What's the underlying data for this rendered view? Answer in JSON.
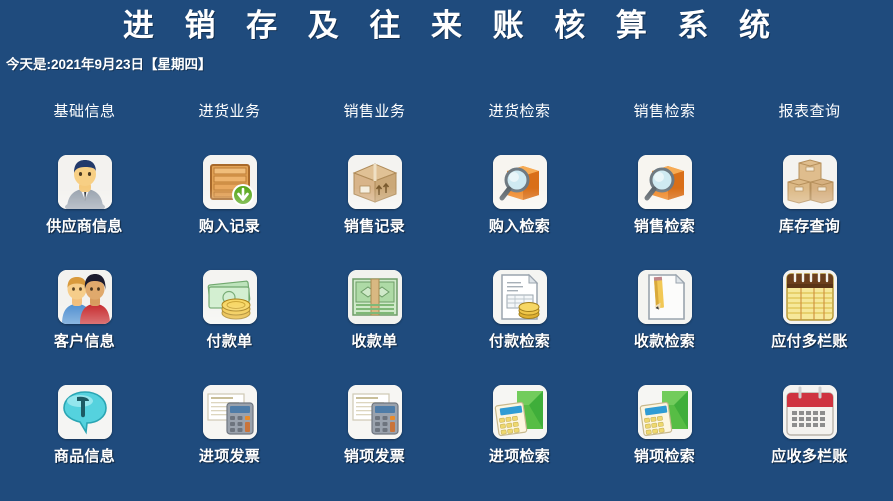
{
  "app": {
    "title": "进 销 存 及 往 来 账 核 算 系 统",
    "date_line": "今天是:2021年9月23日【星期四】",
    "background_color": "#1f4b7d",
    "title_color": "#ffffff",
    "label_color": "#ffffff"
  },
  "columns": [
    {
      "label": "基础信息"
    },
    {
      "label": "进货业务"
    },
    {
      "label": "销售业务"
    },
    {
      "label": "进货检索"
    },
    {
      "label": "销售检索"
    },
    {
      "label": "报表查询"
    }
  ],
  "rows": [
    {
      "tiles": [
        {
          "label": "供应商信息",
          "icon": "supplier-person-icon"
        },
        {
          "label": "购入记录",
          "icon": "crate-download-icon"
        },
        {
          "label": "销售记录",
          "icon": "carton-box-icon"
        },
        {
          "label": "购入检索",
          "icon": "box-magnifier-icon"
        },
        {
          "label": "销售检索",
          "icon": "box-magnifier-icon"
        },
        {
          "label": "库存查询",
          "icon": "stacked-boxes-icon"
        }
      ]
    },
    {
      "tiles": [
        {
          "label": "客户信息",
          "icon": "customers-people-icon"
        },
        {
          "label": "付款单",
          "icon": "cash-coins-icon"
        },
        {
          "label": "收款单",
          "icon": "banknote-stack-icon"
        },
        {
          "label": "付款检索",
          "icon": "document-coins-icon"
        },
        {
          "label": "收款检索",
          "icon": "document-pencil-icon"
        },
        {
          "label": "应付多栏账",
          "icon": "notepad-ledger-icon"
        }
      ]
    },
    {
      "tiles": [
        {
          "label": "商品信息",
          "icon": "teal-bubble-t-icon"
        },
        {
          "label": "进项发票",
          "icon": "invoice-calculator-icon"
        },
        {
          "label": "销项发票",
          "icon": "invoice-calculator-icon"
        },
        {
          "label": "进项检索",
          "icon": "calculator-folder-icon"
        },
        {
          "label": "销项检索",
          "icon": "calculator-folder-icon"
        },
        {
          "label": "应收多栏账",
          "icon": "calendar-red-icon"
        }
      ]
    }
  ]
}
